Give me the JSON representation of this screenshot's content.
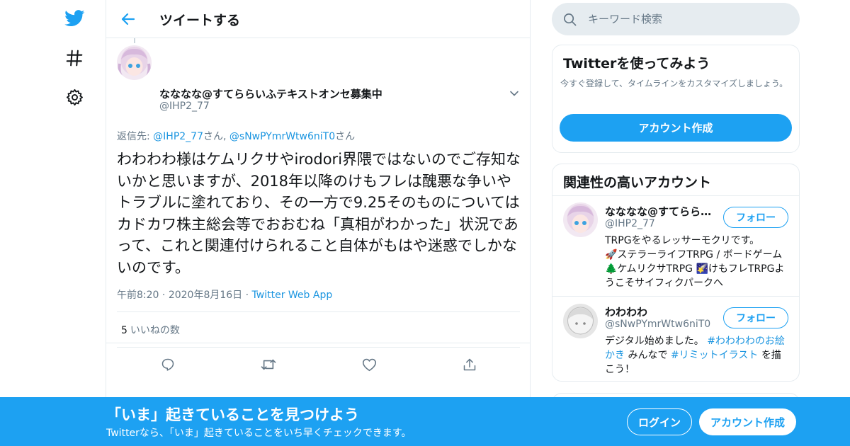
{
  "nav": {
    "icons": [
      "twitter-bird-icon",
      "hashtag-icon",
      "gear-icon"
    ]
  },
  "header": {
    "title": "ツイートする"
  },
  "tweet": {
    "author_name": "なななな@すてららいふテキストオンセ募集中",
    "author_handle": "@IHP2_77",
    "reply_prefix": "返信先: ",
    "reply_user1": "@IHP2_77",
    "reply_suffix1": "さん, ",
    "reply_user2": "@sNwPYmrWtw6niT0",
    "reply_suffix2": "さん",
    "text": "わわわわ様はケムリクサやirodori界隈ではないのでご存知ないかと思いますが、2018年以降のけもフレは醜悪な争いやトラブルに塗れており、その一方で9.25そのものについてはカドカワ株主総会等でおおむね「真相がわかった」状況であって、これと関連付けられること自体がもはや迷惑でしかないのです。",
    "time": "午前8:20",
    "date": "2020年8月16日",
    "sep": "·",
    "source": "Twitter Web App",
    "likes_count": "5",
    "likes_label": "いいねの数"
  },
  "search": {
    "placeholder": "キーワード検索"
  },
  "signup_card": {
    "title": "Twitterを使ってみよう",
    "description": "今すぐ登録して、タイムラインをカスタマイズしましょう。",
    "button": "アカウント作成"
  },
  "related": {
    "title": "関連性の高いアカウント",
    "accounts": [
      {
        "name": "なななな@すてららいふテキストオンセ募集中",
        "handle": "@IHP2_77",
        "follow": "フォロー",
        "bio_1": "TRPGをやるレッサーモクリです。",
        "bio_2": "🚀ステラーライフTRPG / ボードゲーム 🌲ケムリクサTRPG 🌠けもフレTRPGようこそサイフィクパークへ"
      },
      {
        "name": "わわわわ",
        "handle": "@sNwPYmrWtw6niT0",
        "follow": "フォロー",
        "bio_1": "デジタル始めました。",
        "tag1": "#わわわわのお絵かき",
        "bio_2": " みんなで ",
        "tag2": "#リミットイラスト",
        "bio_3": "を描こう！"
      }
    ]
  },
  "banner": {
    "title": "「いま」起きていることを見つけよう",
    "subtitle": "Twitterなら、「いま」起きていることをいち早くチェックできます。",
    "login": "ログイン",
    "signup": "アカウント作成"
  },
  "colors": {
    "brand": "#1da1f2",
    "link": "#1b95e0",
    "secondary_text": "#657786",
    "border": "#e6ecf0"
  }
}
